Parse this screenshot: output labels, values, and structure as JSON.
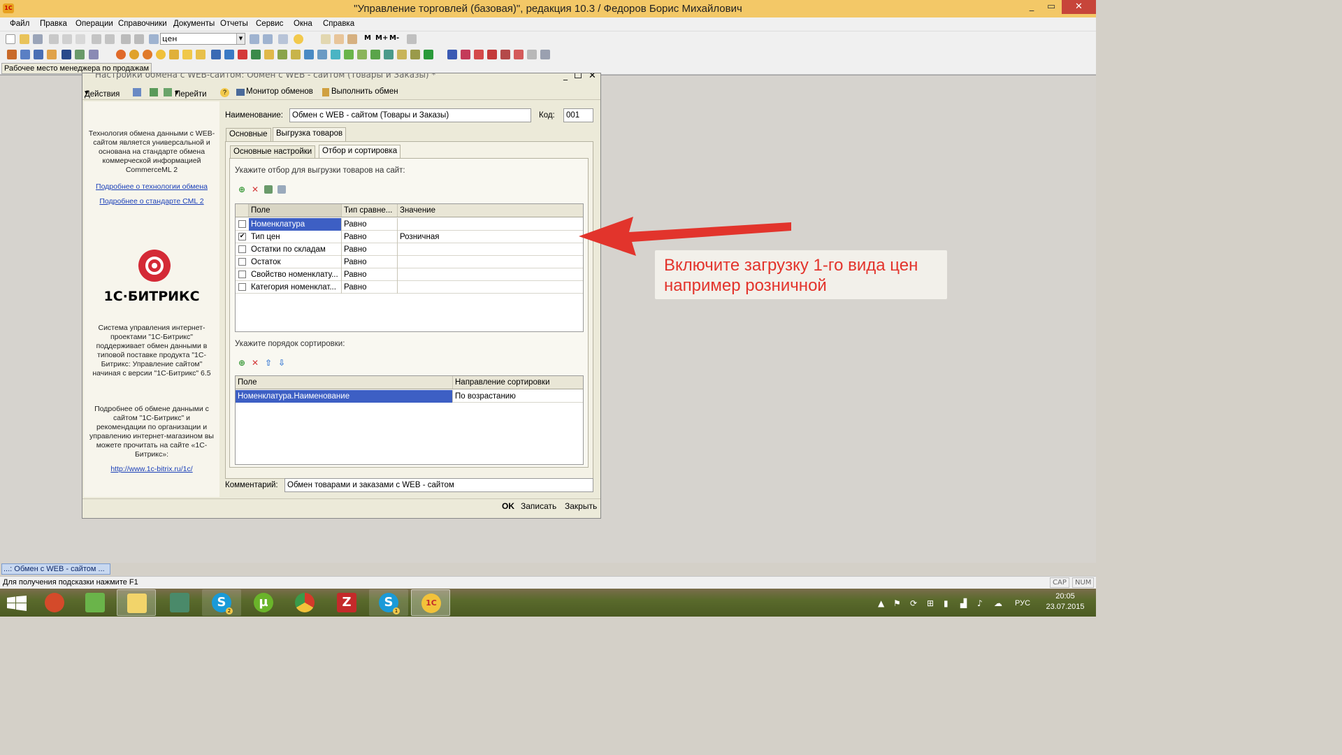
{
  "window": {
    "title": "\"Управление торговлей (базовая)\", редакция 10.3 / Федоров Борис Михайлович",
    "min": "_",
    "max": "▭",
    "close": "✕"
  },
  "menu": [
    "Файл",
    "Правка",
    "Операции",
    "Справочники",
    "Документы",
    "Отчеты",
    "Сервис",
    "Окна",
    "Справка"
  ],
  "toolbar": {
    "search_value": "цен",
    "m_buttons": [
      "M",
      "M+",
      "M-"
    ]
  },
  "open_tab": "Рабочее место менеджера по продажам",
  "dialog": {
    "title": "Настройки обмена с WEB-сайтом: Обмен с WEB - сайтом (Товары и Заказы) *",
    "toolbar": {
      "actions": "Действия",
      "goto": "Перейти",
      "help": "?",
      "monitor": "Монитор обменов",
      "execute": "Выполнить обмен"
    },
    "left": {
      "tech_text": "Технология обмена данными с WEB-сайтом является универсальной и основана на стандарте обмена коммерческой информацией CommerceML 2",
      "link_tech": "Подробнее о технологии обмена",
      "link_cml": "Подробнее о стандарте CML 2",
      "logo_text": "1С·БИТРИКС",
      "system_text": "Система управления интернет-проектами \"1С-Битрикс\" поддерживает обмен данными в типовой поставке продукта \"1С-Битрикс: Управление сайтом\" начиная с версии \"1С-Битрикс\" 6.5",
      "more_text": "Подробнее об обмене данными с сайтом \"1С-Битрикс\" и рекомендации по организации и управлению интернет-магазином вы можете прочитать на сайте «1С-Битрикс»:",
      "url": "http://www.1c-bitrix.ru/1c/"
    },
    "name_label": "Наименование:",
    "name_value": "Обмен с WEB - сайтом (Товары и Заказы)",
    "code_label": "Код:",
    "code_value": "001",
    "tabs": [
      "Основные",
      "Выгрузка товаров"
    ],
    "subtabs": [
      "Основные настройки",
      "Отбор и сортировка"
    ],
    "filter_caption": "Укажите отбор для выгрузки товаров на сайт:",
    "filter_headers": [
      "Поле",
      "Тип сравне...",
      "Значение"
    ],
    "filter_rows": [
      {
        "checked": false,
        "field": "Номенклатура",
        "cmp": "Равно",
        "value": ""
      },
      {
        "checked": true,
        "field": "Тип цен",
        "cmp": "Равно",
        "value": "Розничная"
      },
      {
        "checked": false,
        "field": "Остатки по складам",
        "cmp": "Равно",
        "value": ""
      },
      {
        "checked": false,
        "field": "Остаток",
        "cmp": "Равно",
        "value": ""
      },
      {
        "checked": false,
        "field": "Свойство номенклату...",
        "cmp": "Равно",
        "value": ""
      },
      {
        "checked": false,
        "field": "Категория номенклат...",
        "cmp": "Равно",
        "value": ""
      }
    ],
    "sort_caption": "Укажите порядок сортировки:",
    "sort_headers": [
      "Поле",
      "Направление сортировки"
    ],
    "sort_rows": [
      {
        "field": "Номенклатура.Наименование",
        "dir": "По возрастанию"
      }
    ],
    "comment_label": "Комментарий:",
    "comment_value": "Обмен товарами и заказами с WEB - сайтом",
    "buttons": {
      "ok": "OK",
      "save": "Записать",
      "close": "Закрыть"
    }
  },
  "callout": {
    "line1": "Включите загрузку 1-го вида цен",
    "line2": "например розничной",
    "color": "#e3342c"
  },
  "task_window": "...: Обмен с WEB - сайтом ...",
  "status": {
    "hint": "Для получения подсказки нажмите F1",
    "cap": "CAP",
    "num": "NUM"
  },
  "taskbar": {
    "lang": "РУС",
    "time": "20:05",
    "date": "23.07.2015",
    "skype_badge_1": "2",
    "skype_badge_2": "1"
  }
}
